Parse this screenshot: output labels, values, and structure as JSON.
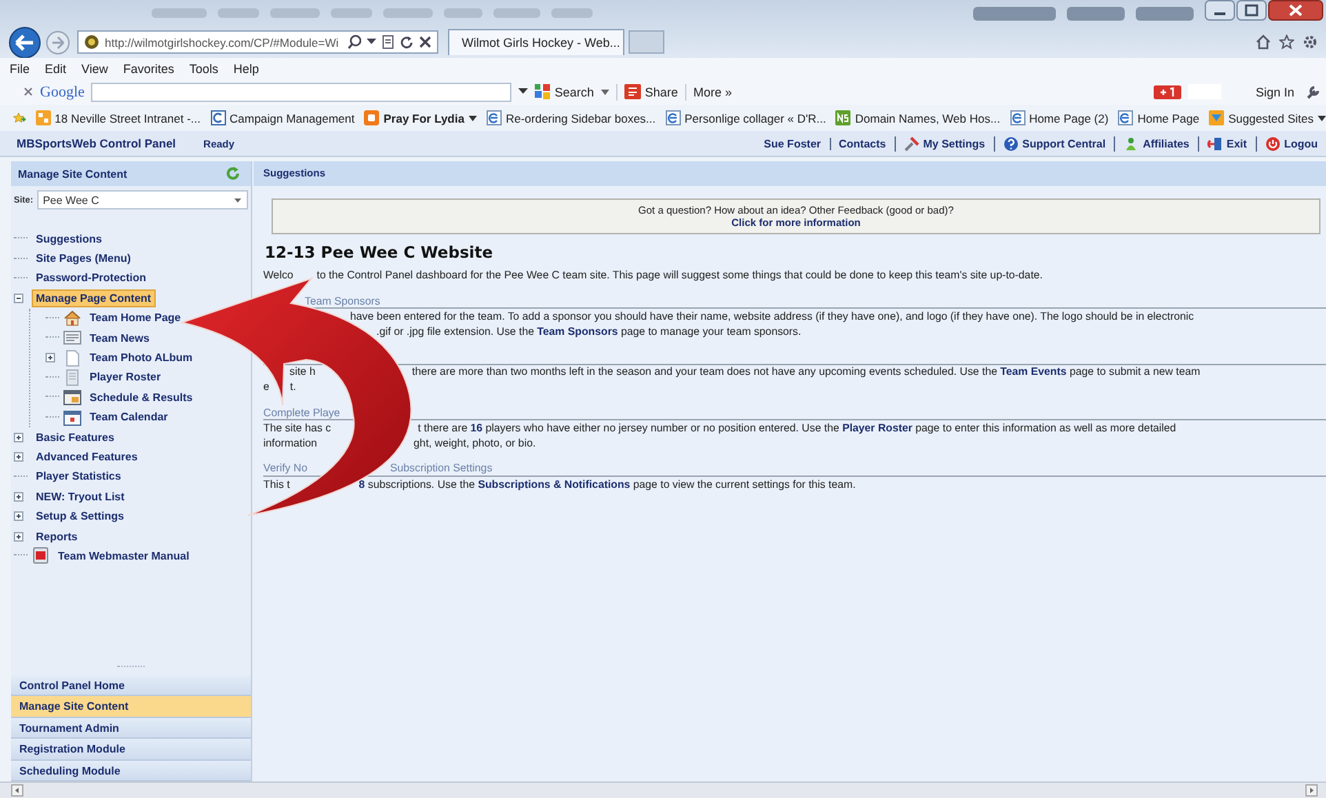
{
  "browser": {
    "url": "http://wilmotgirlshockey.com/CP/#Module=Wi",
    "tab_title": "Wilmot Girls Hockey - Web...",
    "menu": [
      "File",
      "Edit",
      "View",
      "Favorites",
      "Tools",
      "Help"
    ],
    "toolbar": {
      "brand": "Google",
      "search_label": "Search",
      "share_label": "Share",
      "more_label": "More »",
      "sign_in": "Sign In"
    },
    "favorites": [
      {
        "label": "18 Neville Street Intranet -...",
        "dropdown": false
      },
      {
        "label": "Campaign Management",
        "dropdown": false
      },
      {
        "label": "Pray For Lydia",
        "dropdown": true
      },
      {
        "label": "Re-ordering Sidebar boxes...",
        "dropdown": false
      },
      {
        "label": "Personlige collager « D'R...",
        "dropdown": false
      },
      {
        "label": "Domain Names, Web Hos...",
        "dropdown": false
      },
      {
        "label": "Home Page (2)",
        "dropdown": false
      },
      {
        "label": "Home Page",
        "dropdown": false
      },
      {
        "label": "Suggested Sites",
        "dropdown": true
      }
    ]
  },
  "app": {
    "title": "MBSportsWeb Control Panel",
    "status": "Ready",
    "header_links": [
      {
        "label": "Sue Foster",
        "kind": "text"
      },
      {
        "label": "Contacts",
        "kind": "text"
      },
      {
        "label": "My Settings",
        "kind": "settings"
      },
      {
        "label": "Support Central",
        "kind": "help"
      },
      {
        "label": "Affiliates",
        "kind": "affiliates"
      },
      {
        "label": "Exit",
        "kind": "exit"
      },
      {
        "label": "Logou",
        "kind": "logout"
      }
    ]
  },
  "sidebar": {
    "title": "Manage Site Content",
    "site_label": "Site:",
    "site_value": "Pee Wee C",
    "tree": [
      {
        "label": "Suggestions",
        "kind": "link",
        "selected": false
      },
      {
        "label": "Site Pages (Menu)",
        "kind": "link",
        "selected": false
      },
      {
        "label": "Password-Protection",
        "kind": "link",
        "selected": false
      },
      {
        "label": "Manage Page Content",
        "kind": "link",
        "selected": true,
        "expanded": true,
        "children": [
          {
            "label": "Team Home Page",
            "kind": "home",
            "selected": false
          },
          {
            "label": "Team News",
            "kind": "news",
            "selected": false
          },
          {
            "label": "Team Photo ALbum",
            "kind": "album",
            "selected": false,
            "expanded": false
          },
          {
            "label": "Player Roster",
            "kind": "roster",
            "selected": false
          },
          {
            "label": "Schedule & Results",
            "kind": "schedule",
            "selected": false
          },
          {
            "label": "Team Calendar",
            "kind": "calendar",
            "selected": false
          }
        ]
      },
      {
        "label": "Basic Features",
        "kind": "link",
        "selected": false,
        "expanded": false
      },
      {
        "label": "Advanced Features",
        "kind": "link",
        "selected": false,
        "expanded": false
      },
      {
        "label": "Player Statistics",
        "kind": "link",
        "selected": false
      },
      {
        "label": "NEW: Tryout List",
        "kind": "link",
        "selected": false,
        "expanded": false
      },
      {
        "label": "Setup & Settings",
        "kind": "link",
        "selected": false,
        "expanded": false
      },
      {
        "label": "Reports",
        "kind": "link",
        "selected": false,
        "expanded": false
      },
      {
        "label": "Team Webmaster Manual",
        "kind": "manual",
        "selected": false
      }
    ],
    "modules": [
      {
        "label": "Control Panel Home",
        "selected": false
      },
      {
        "label": "Manage Site Content",
        "selected": true
      },
      {
        "label": "Tournament Admin",
        "selected": false
      },
      {
        "label": "Registration Module",
        "selected": false
      },
      {
        "label": "Scheduling Module",
        "selected": false
      }
    ]
  },
  "main": {
    "header": "Suggestions",
    "feedback": {
      "question": "Got a question? How about an idea? Other Feedback (good or bad)?",
      "link": "Click for more information"
    },
    "title": "12-13 Pee Wee C Website",
    "intro": [
      "Welco",
      "to the Control Panel dashboard for the Pee Wee C team site. This page will suggest some things that could be done to keep this team's site up-to-date."
    ],
    "sections": [
      {
        "heading": [
          "Team Sponsors"
        ],
        "lines": [
          [
            "have been entered for the team. To add a sponsor you should have their name, website address (if they have one), and logo (if they have one). The logo should be in electronic"
          ],
          [
            ".gif or .jpg file extension. Use the **Team Sponsors** page to manage your team sponsors."
          ]
        ]
      },
      {
        "lines": [
          [
            "site h",
            "there are more than two months left in the season and your team does not have any upcoming events scheduled. Use the **Team Events** page to submit a new team"
          ],
          [
            "e",
            "t."
          ]
        ]
      },
      {
        "heading": [
          "Complete Playe"
        ],
        "lines": [
          [
            "The site has c",
            "t there are **16** players who have either no jersey number or no position entered. Use the **Player Roster** page to enter this information as well as more detailed"
          ],
          [
            "information",
            "ght, weight, photo, or bio."
          ]
        ]
      },
      {
        "heading": [
          "Verify No",
          "Subscription Settings"
        ],
        "lines": [
          [
            "This t",
            "**8** subscriptions. Use the **Subscriptions & Notifications** page to view the current settings for this team."
          ]
        ]
      }
    ]
  }
}
